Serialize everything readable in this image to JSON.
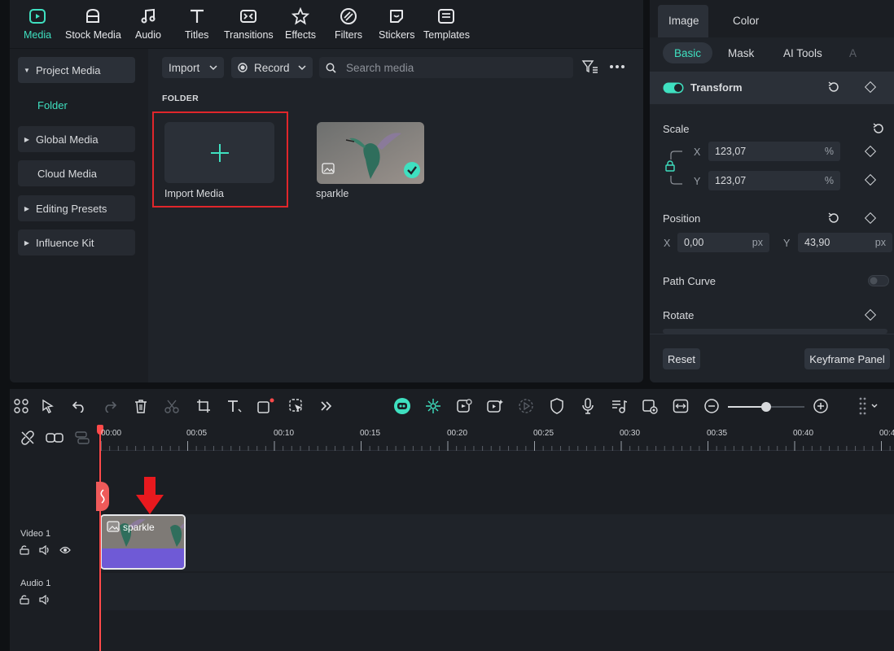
{
  "top_tabs": [
    {
      "label": "Media",
      "icon": "media-icon",
      "active": true
    },
    {
      "label": "Stock Media",
      "icon": "stock-media-icon"
    },
    {
      "label": "Audio",
      "icon": "music-note-icon"
    },
    {
      "label": "Titles",
      "icon": "text-t-icon"
    },
    {
      "label": "Transitions",
      "icon": "transitions-icon"
    },
    {
      "label": "Effects",
      "icon": "effects-icon"
    },
    {
      "label": "Filters",
      "icon": "filters-icon"
    },
    {
      "label": "Stickers",
      "icon": "stickers-icon"
    },
    {
      "label": "Templates",
      "icon": "templates-icon"
    }
  ],
  "sidebar": {
    "items": [
      {
        "label": "Project Media"
      },
      {
        "label": "Folder"
      },
      {
        "label": "Global Media"
      },
      {
        "label": "Cloud Media"
      },
      {
        "label": "Editing Presets"
      },
      {
        "label": "Influence Kit"
      }
    ]
  },
  "media_toolbar": {
    "import_label": "Import",
    "record_label": "Record",
    "search_placeholder": "Search media"
  },
  "library": {
    "folder_heading": "FOLDER",
    "import_tile_label": "Import Media",
    "clip_name": "sparkle"
  },
  "properties": {
    "tabs": [
      "Image",
      "Color"
    ],
    "subtabs": [
      "Basic",
      "Mask",
      "AI Tools",
      "A"
    ],
    "transform_label": "Transform",
    "scale_label": "Scale",
    "scale_x": "123,07",
    "scale_y": "123,07",
    "percent_unit": "%",
    "position_label": "Position",
    "position_x": "0,00",
    "position_y": "43,90",
    "px_unit": "px",
    "axis_x": "X",
    "axis_y": "Y",
    "path_curve_label": "Path Curve",
    "rotate_label": "Rotate",
    "reset_label": "Reset",
    "keyframe_panel_label": "Keyframe Panel"
  },
  "timeline": {
    "ruler": [
      "00:00",
      "00:05",
      "00:10",
      "00:15",
      "00:20",
      "00:25",
      "00:30",
      "00:35",
      "00:40",
      "00:4"
    ],
    "video_track_label": "Video 1",
    "audio_track_label": "Audio 1",
    "clip_label": "sparkle",
    "zoom_level": 0.5
  },
  "colors": {
    "accent": "#3fe0c0",
    "highlight_box": "#e0262b",
    "clip_bar": "#6f5ad6",
    "playhead": "#ff4a4a"
  }
}
